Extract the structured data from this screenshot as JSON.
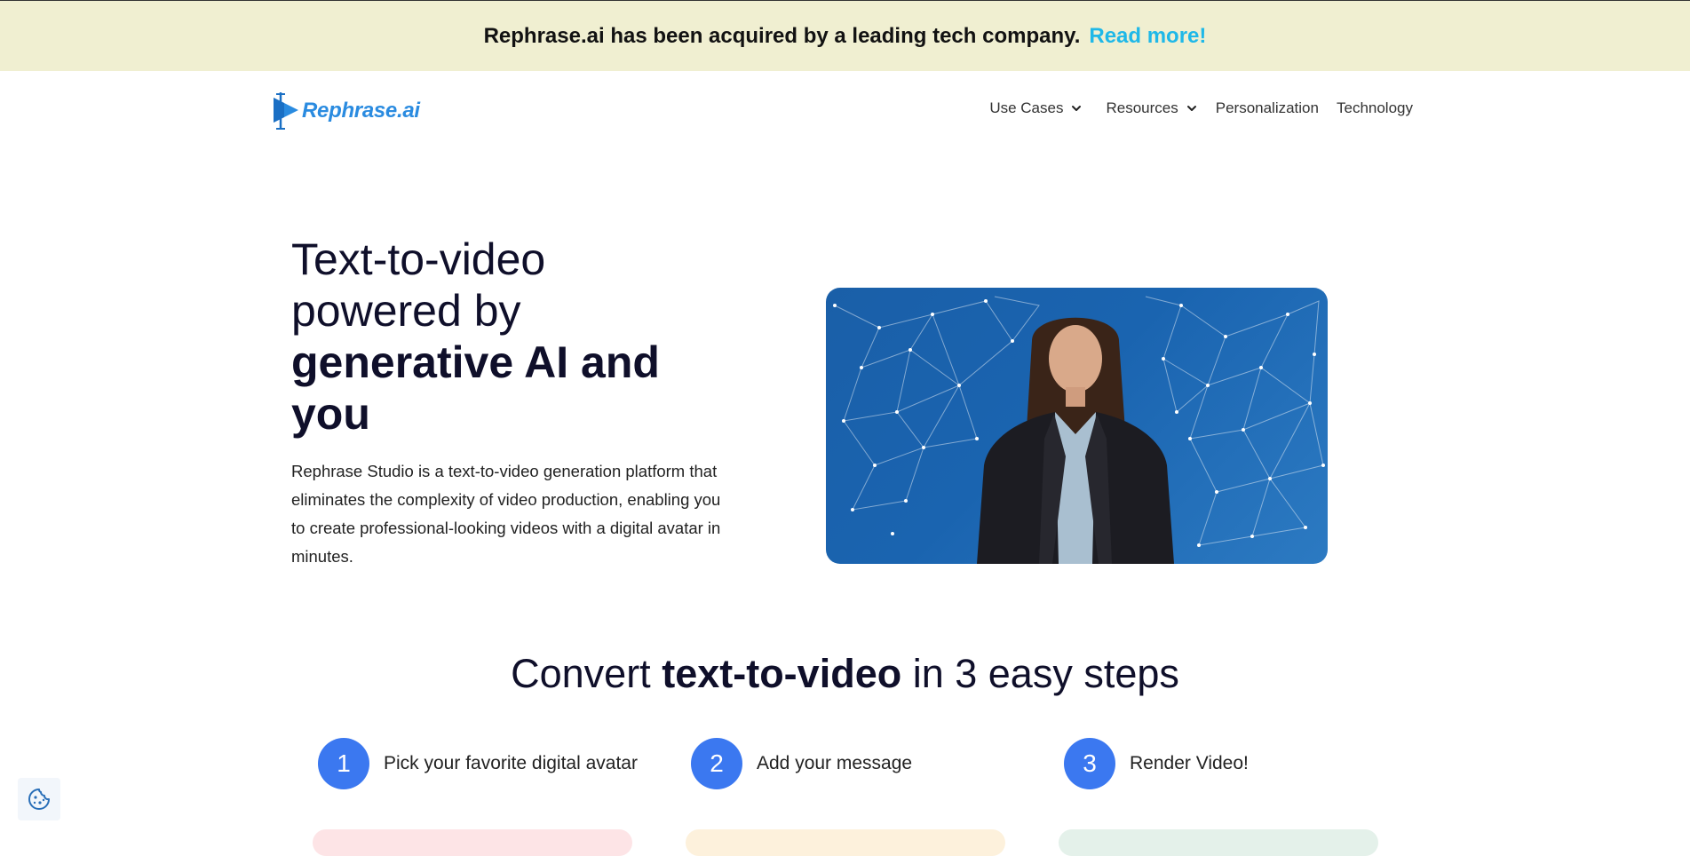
{
  "announcement": {
    "message": "Rephrase.ai has been acquired by a leading tech company.",
    "link_label": "Read more!"
  },
  "nav": {
    "logo_text": "Rephrase.ai",
    "items": [
      {
        "label": "Use Cases",
        "has_dropdown": true
      },
      {
        "label": "Resources",
        "has_dropdown": true
      },
      {
        "label": "Personalization",
        "has_dropdown": false
      },
      {
        "label": "Technology",
        "has_dropdown": false
      }
    ]
  },
  "hero": {
    "title_line1": "Text-to-video",
    "title_line2": "powered by",
    "title_bold": "generative AI and you",
    "description": "Rephrase Studio is a text-to-video generation platform that eliminates the complexity of video production, enabling you to create professional-looking videos with a digital avatar in minutes."
  },
  "steps": {
    "title_prefix": "Convert",
    "title_bold": "text-to-video",
    "title_suffix": "in 3 easy steps",
    "items": [
      {
        "number": "1",
        "label": "Pick your favorite digital avatar"
      },
      {
        "number": "2",
        "label": "Add your message"
      },
      {
        "number": "3",
        "label": "Render Video!"
      }
    ]
  },
  "colors": {
    "announcement_bg": "#f0efd1",
    "link": "#1fb8e8",
    "brand": "#2a8be0",
    "step_circle": "#3b78f0",
    "hero_media_bg": "#1a64b0"
  },
  "icons": {
    "logo": "rephrase-logo-icon",
    "dropdown": "chevron-down-icon",
    "cookie": "cookie-icon"
  }
}
